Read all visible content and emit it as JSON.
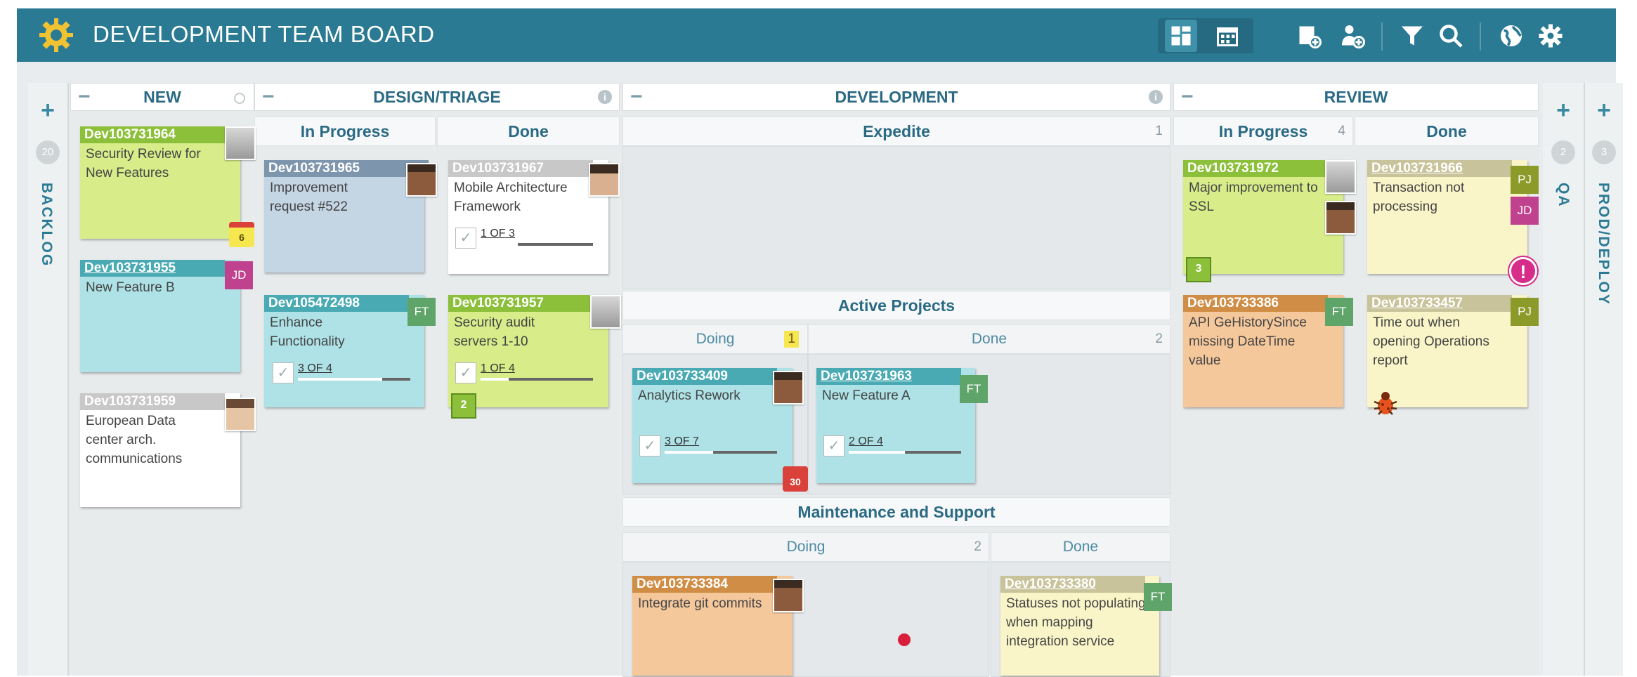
{
  "header": {
    "title": "DEVELOPMENT TEAM BOARD",
    "icons": [
      "logo-icon",
      "board-view-icon",
      "calendar-icon",
      "add-card-icon",
      "add-user-icon",
      "filter-icon",
      "search-icon",
      "globe-icon",
      "settings-icon"
    ]
  },
  "backlog": {
    "label": "BACKLOG",
    "count": "20"
  },
  "qa": {
    "label": "QA",
    "count": "2"
  },
  "prod": {
    "label": "PROD/DEPLOY",
    "count": "3"
  },
  "columns": {
    "new": {
      "title": "NEW"
    },
    "design": {
      "title": "DESIGN/TRIAGE",
      "in_progress": "In Progress",
      "done": "Done"
    },
    "dev": {
      "title": "DEVELOPMENT",
      "expedite": "Expedite",
      "expedite_count": "1",
      "active": "Active Projects",
      "active_doing": "Doing",
      "active_doing_count": "1",
      "active_done": "Done",
      "active_done_count": "2",
      "maint": "Maintenance and Support",
      "maint_doing": "Doing",
      "maint_doing_count": "2",
      "maint_done": "Done"
    },
    "review": {
      "title": "REVIEW",
      "in_progress": "In Progress",
      "in_progress_count": "4",
      "done": "Done"
    }
  },
  "cards": {
    "c1": {
      "id": "Dev103731964",
      "title": "Security Review for New Features",
      "due": "6"
    },
    "c2": {
      "id": "Dev103731955",
      "title": "New Feature B",
      "owner": "JD"
    },
    "c3": {
      "id": "Dev103731959",
      "title": "European Data center arch. communications"
    },
    "c4": {
      "id": "Dev103731965",
      "title": "Improvement request #522"
    },
    "c5": {
      "id": "Dev105472498",
      "title": "Enhance Functionality",
      "owner": "FT",
      "task_done": "3",
      "task_of": "OF",
      "task_total": "4",
      "progress": 0.75
    },
    "c6": {
      "id": "Dev103731967",
      "title": "Mobile Architecture Framework",
      "task_done": "1",
      "task_of": "OF",
      "task_total": "3",
      "progress": 0.33
    },
    "c7": {
      "id": "Dev103731957",
      "title": "Security audit servers 1-10",
      "task_done": "1",
      "task_of": "OF",
      "task_total": "4",
      "progress": 0.25,
      "blocked": "2"
    },
    "c8": {
      "id": "Dev103733409",
      "title": "Analytics Rework",
      "task_done": "3",
      "task_of": "OF",
      "task_total": "7",
      "progress": 0.43,
      "due": "30"
    },
    "c9": {
      "id": "Dev103731963",
      "title": "New Feature A",
      "owner": "FT",
      "task_done": "2",
      "task_of": "OF",
      "task_total": "4",
      "progress": 0.5
    },
    "c10": {
      "id": "Dev103733384",
      "title": "Integrate git commits"
    },
    "c11": {
      "id": "Dev103733380",
      "title": "Statuses not populating when mapping integration service",
      "owner": "FT"
    },
    "c12": {
      "id": "Dev103731972",
      "title": "Major improvement to SSL",
      "blocked": "3"
    },
    "c13": {
      "id": "Dev103733386",
      "title": "API GeHistorySince missing DateTime value",
      "owner": "FT"
    },
    "c14": {
      "id": "Dev103731966",
      "title": "Transaction not processing",
      "owner": "PJ",
      "owner2": "JD",
      "alert": "!"
    },
    "c15": {
      "id": "Dev103733457",
      "title": "Time out when opening Operations report",
      "owner": "PJ"
    }
  }
}
